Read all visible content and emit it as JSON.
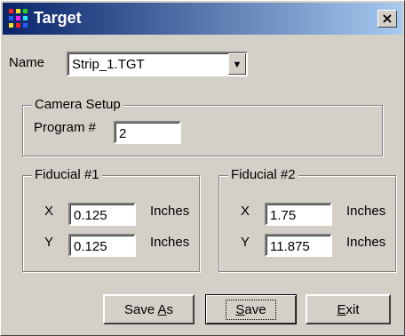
{
  "window": {
    "title": "Target",
    "close_glyph": "×"
  },
  "name_row": {
    "label": "Name",
    "value": "Strip_1.TGT",
    "dropdown_icon": "chevron-down-icon"
  },
  "camera": {
    "legend": "Camera Setup",
    "program_label": "Program #",
    "program_value": "2"
  },
  "fiducial1": {
    "legend": "Fiducial #1",
    "x_label": "X",
    "x_value": "0.125",
    "x_unit": "Inches",
    "y_label": "Y",
    "y_value": "0.125",
    "y_unit": "Inches"
  },
  "fiducial2": {
    "legend": "Fiducial #2",
    "x_label": "X",
    "x_value": "1.75",
    "x_unit": "Inches",
    "y_label": "Y",
    "y_value": "11.875",
    "y_unit": "Inches"
  },
  "buttons": {
    "save_as": {
      "pre": "Save ",
      "mn": "A",
      "post": "s"
    },
    "save": {
      "pre": "",
      "mn": "S",
      "post": "ave"
    },
    "exit": {
      "pre": "",
      "mn": "E",
      "post": "xit"
    }
  },
  "colors": {
    "titlebar_start": "#0a246a",
    "titlebar_end": "#a6caf0",
    "face": "#d4d0c8"
  }
}
